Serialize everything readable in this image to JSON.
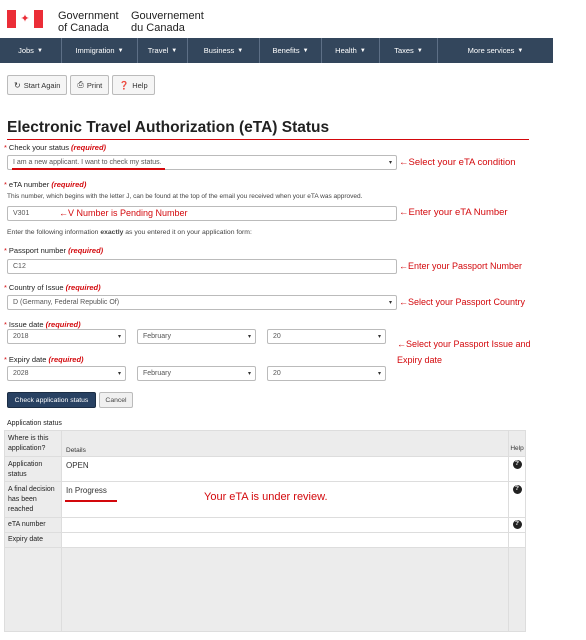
{
  "header": {
    "gov_en_line1": "Government",
    "gov_en_line2": "of Canada",
    "gov_fr_line1": "Gouvernement",
    "gov_fr_line2": "du Canada",
    "flag_icon": "maple-leaf-icon"
  },
  "nav": {
    "items": [
      {
        "label": "Jobs"
      },
      {
        "label": "Immigration"
      },
      {
        "label": "Travel"
      },
      {
        "label": "Business"
      },
      {
        "label": "Benefits"
      },
      {
        "label": "Health"
      },
      {
        "label": "Taxes"
      },
      {
        "label": "More services"
      }
    ]
  },
  "toolbar": {
    "start_again": "Start Again",
    "print": "Print",
    "help": "Help"
  },
  "page": {
    "title": "Electronic Travel Authorization (eTA) Status",
    "required_text": "(required)"
  },
  "form": {
    "status_label": "Check your status",
    "status_value": "I am a new applicant. I want to check my status.",
    "eta_label": "eTA number",
    "eta_help": "This number, which begins with the letter J, can be found at the top of the email you received when your eTA was approved.",
    "eta_value": "V301",
    "enter_info_pre": "Enter the following information ",
    "enter_info_bold": "exactly",
    "enter_info_post": " as you entered it on your application form:",
    "passport_label": "Passport number",
    "passport_value": "C12",
    "country_label": "Country of Issue",
    "country_value": "D (Germany, Federal Republic Of)",
    "issue_label": "Issue date",
    "issue_year": "2018",
    "issue_month": "February",
    "issue_day": "20",
    "expiry_label": "Expiry date",
    "expiry_year": "2028",
    "expiry_month": "February",
    "expiry_day": "20",
    "submit_label": "Check application status",
    "cancel_label": "Cancel"
  },
  "annotations": {
    "condition": "←Select your eTA condition",
    "v_number": "←V Number is Pending Number",
    "eta_number": "←Enter your eTA Number",
    "passport_number": "←Enter your Passport Number",
    "passport_country": "←Select your Passport Country",
    "issue_expiry_line1": "←Select your Passport Issue and",
    "issue_expiry_line2": "Expiry date",
    "under_review": "Your eTA is under review."
  },
  "status_table": {
    "caption": "Application status",
    "head_col1": "Where is this application?",
    "head_col2": "Details",
    "head_col3": "Help",
    "rows": [
      {
        "label": "Application status",
        "value": "OPEN",
        "help": true
      },
      {
        "label": "A final decision has been reached",
        "value": "In Progress",
        "help": true
      },
      {
        "label": "eTA number",
        "value": "",
        "help": true
      },
      {
        "label": "Expiry date",
        "value": "",
        "help": false
      }
    ]
  }
}
